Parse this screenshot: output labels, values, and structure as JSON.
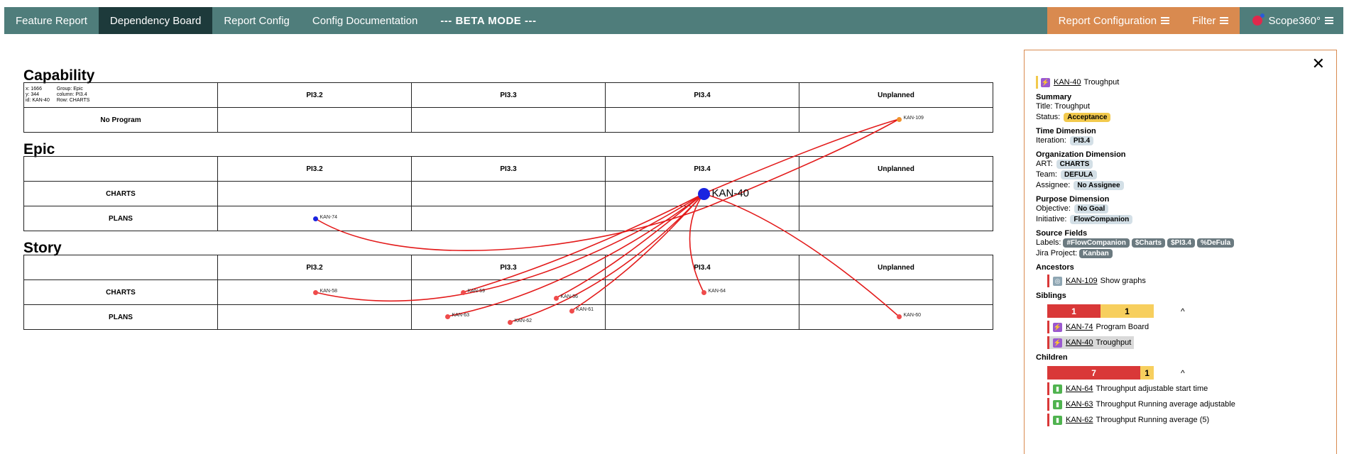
{
  "nav": {
    "items": [
      {
        "label": "Feature Report"
      },
      {
        "label": "Dependency Board"
      },
      {
        "label": "Report Config"
      },
      {
        "label": "Config Documentation"
      },
      {
        "label": "--- BETA MODE ---"
      }
    ],
    "report_configuration": "Report Configuration",
    "filter": "Filter",
    "brand": "Scope360°"
  },
  "board": {
    "capability": {
      "title": "Capability",
      "hover_info": {
        "x": "x: 1666",
        "y": "y: 344",
        "id": "id: KAN-40",
        "group": "Group: Epic",
        "column": "column: PI3.4",
        "row": "Row: CHARTS"
      },
      "columns": [
        "PI3.2",
        "PI3.3",
        "PI3.4",
        "Unplanned"
      ],
      "rows": [
        "No Program"
      ]
    },
    "epic": {
      "title": "Epic",
      "columns": [
        "PI3.2",
        "PI3.3",
        "PI3.4",
        "Unplanned"
      ],
      "rows": [
        "CHARTS",
        "PLANS"
      ]
    },
    "story": {
      "title": "Story",
      "columns": [
        "PI3.2",
        "PI3.3",
        "PI3.4",
        "Unplanned"
      ],
      "rows": [
        "CHARTS",
        "PLANS"
      ]
    },
    "nodes": [
      {
        "id": "KAN-109",
        "color": "#f0922b"
      },
      {
        "id": "KAN-40",
        "color": "#1a24e0"
      },
      {
        "id": "KAN-74",
        "color": "#1a24e0"
      },
      {
        "id": "KAN-58",
        "color": "#ef4b4b"
      },
      {
        "id": "KAN-59",
        "color": "#ef4b4b"
      },
      {
        "id": "KAN-56",
        "color": "#ef4b4b"
      },
      {
        "id": "KAN-64",
        "color": "#ef4b4b"
      },
      {
        "id": "KAN-61",
        "color": "#ef4b4b"
      },
      {
        "id": "KAN-63",
        "color": "#ef4b4b"
      },
      {
        "id": "KAN-62",
        "color": "#ef4b4b"
      },
      {
        "id": "KAN-60",
        "color": "#ef4b4b"
      }
    ],
    "link_color": "#e31b1b"
  },
  "panel": {
    "title_id": "KAN-40",
    "title_name": "Troughput",
    "summary": {
      "heading": "Summary",
      "title": "Title: Troughput",
      "status_label": "Status:",
      "status": "Acceptance"
    },
    "time": {
      "heading": "Time Dimension",
      "iteration_label": "Iteration:",
      "iteration": "PI3.4"
    },
    "org": {
      "heading": "Organization Dimension",
      "art_label": "ART:",
      "art": "CHARTS",
      "team_label": "Team:",
      "team": "DEFULA",
      "assignee_label": "Assignee:",
      "assignee": "No Assignee"
    },
    "purpose": {
      "heading": "Purpose Dimension",
      "objective_label": "Objective:",
      "objective": "No Goal",
      "initiative_label": "Initiative:",
      "initiative": "FlowCompanion"
    },
    "source": {
      "heading": "Source Fields",
      "labels_label": "Labels:",
      "labels": [
        "#FlowCompanion",
        "$Charts",
        "$PI3.4",
        "%DeFula"
      ],
      "jira_label": "Jira Project:",
      "jira": "Kanban"
    },
    "ancestors": {
      "heading": "Ancestors",
      "items": [
        {
          "id": "KAN-109",
          "name": "Show graphs"
        }
      ]
    },
    "siblings": {
      "heading": "Siblings",
      "bar": [
        {
          "value": "1",
          "color": "#d93838"
        },
        {
          "value": "1",
          "color": "#f7cf5e"
        }
      ],
      "items": [
        {
          "id": "KAN-74",
          "name": "Program Board"
        },
        {
          "id": "KAN-40",
          "name": "Troughput"
        }
      ]
    },
    "children": {
      "heading": "Children",
      "bar": [
        {
          "value": "7",
          "color": "#d93838"
        },
        {
          "value": "1",
          "color": "#f7cf5e"
        }
      ],
      "items": [
        {
          "id": "KAN-64",
          "name": "Throughput adjustable start time"
        },
        {
          "id": "KAN-63",
          "name": "Throughput Running average adjustable"
        },
        {
          "id": "KAN-62",
          "name": "Throughput Running average (5)"
        }
      ]
    }
  }
}
